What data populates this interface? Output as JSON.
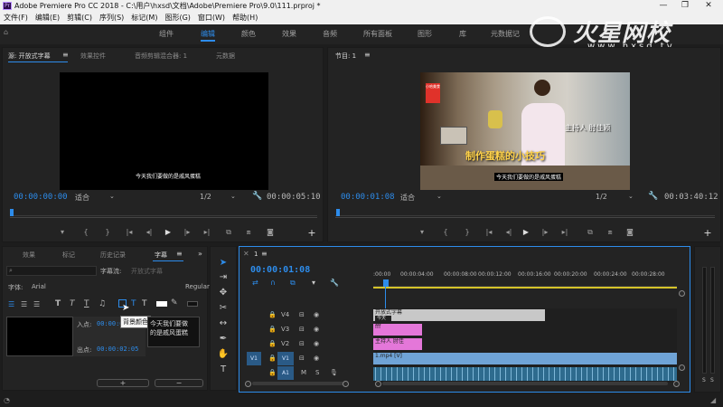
{
  "window": {
    "title": "Adobe Premiere Pro CC 2018 - C:\\用户\\hxsd\\文档\\Adobe\\Premiere Pro\\9.0\\111.prproj *",
    "app_icon": "Pr",
    "minimize": "—",
    "maximize": "❐",
    "close": "✕"
  },
  "menu": [
    "文件(F)",
    "编辑(E)",
    "剪辑(C)",
    "序列(S)",
    "标记(M)",
    "图形(G)",
    "窗口(W)",
    "帮助(H)"
  ],
  "workspaces": [
    "组件",
    "编辑",
    "颜色",
    "效果",
    "音频",
    "所有面板",
    "图形",
    "库",
    "元数据记"
  ],
  "active_workspace": "编辑",
  "watermark": {
    "brand": "火星网校",
    "url": "www.hxsd.tv"
  },
  "source_panel": {
    "tabs": [
      "源: 开放式字幕",
      "效果控件",
      "音频剪辑混合器: 1",
      "元数据"
    ],
    "caption_text": "今天我们要做的是戚风蛋糕",
    "timecode_in": "00:00:00:00",
    "fit": "适合",
    "ratio": "1/2",
    "timecode_out": "00:00:05:10"
  },
  "program_panel": {
    "tab": "节目: 1",
    "timecode_in": "00:00:01:08",
    "fit": "适合",
    "ratio": "1/2",
    "timecode_out": "00:03:40:12",
    "overlay_host": "主持人 肘佳颖",
    "overlay_title": "制作蛋糕的小技巧",
    "overlay_caption": "今天我们要做的是戚风蛋糕",
    "badge_text": "小哈美食"
  },
  "captions_panel": {
    "tabs": [
      "效果",
      "标记",
      "历史记录",
      "字幕"
    ],
    "search_placeholder": "",
    "caption_stream": "字幕流:",
    "caption_stream_value": "开放式字幕",
    "font_label": "字体:",
    "font_value": "Arial",
    "style_value": "Regular",
    "in_label": "入点:",
    "in_value": "00:00:00:00",
    "out_label": "出点:",
    "out_value": "00:00:02:05",
    "tooltip": "背景颜色",
    "caption_line1": "今天我们要做",
    "caption_line2": "的是戚风蛋糕",
    "add_btn": "+",
    "remove_btn": "−"
  },
  "timeline": {
    "tab": "1",
    "timecode": "00:00:01:08",
    "ruler": [
      ":00:00",
      "00:00:04:00",
      "00:00:08:00",
      "00:00:12:00",
      "00:00:16:00",
      "00:00:20:00",
      "00:00:24:00",
      "00:00:28:00"
    ],
    "tracks": [
      {
        "name": "V4",
        "clip": "开放式字幕"
      },
      {
        "name": "V3",
        "clip": "fff"
      },
      {
        "name": "V2",
        "clip": "主持人 肘佳"
      },
      {
        "name": "V1",
        "clip": "1.mp4 [V]"
      },
      {
        "name": "A1",
        "clip": ""
      }
    ],
    "audio_m": "M",
    "audio_s": "S",
    "subclip_label": "今天"
  },
  "meter": {
    "labels": [
      "S",
      "S"
    ]
  },
  "colors": {
    "accent": "#2d8ceb",
    "v1_clip": "#6fa3d6",
    "v2_clip": "#e477d9",
    "v4_clip": "#c8c8c8",
    "playhead": "#2d8ceb"
  }
}
